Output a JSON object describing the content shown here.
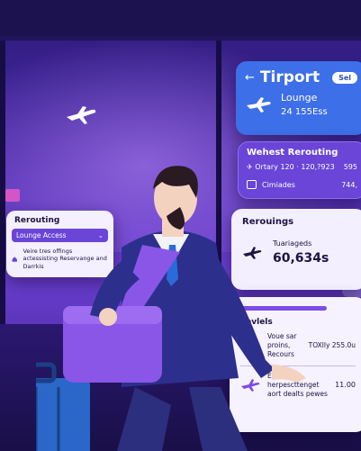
{
  "main_card": {
    "title": "Tirport",
    "pill": "Sel",
    "line1": "Lounge",
    "line2": "24 155Ess"
  },
  "reroute_card": {
    "title": "Wehest Rerouting",
    "row1_left": "Ortary 120  ·  120,?923",
    "row1_right": "595",
    "row2_left": "Cimiades",
    "row2_right": "744,"
  },
  "reroutings_card": {
    "title": "Rerouings",
    "sub": "Tuariageds",
    "value": "60,634s"
  },
  "events_card": {
    "title": "Eevlels",
    "row1_text": "Voue sar proins, Recours",
    "row1_right": "TOXlly 255.0u",
    "row2_text": "Eatll herpescttenget aort dealts pewes",
    "row2_right": "11.00"
  },
  "left_card": {
    "title": "Rerouting",
    "select": "Lounge Access",
    "body": "Veire tres offings actessisting Reservange and Darrkis"
  },
  "colors": {
    "main_blue": "#3d6fe8",
    "accent_purple": "#6a45d8",
    "card_white": "#f4f0ff"
  }
}
